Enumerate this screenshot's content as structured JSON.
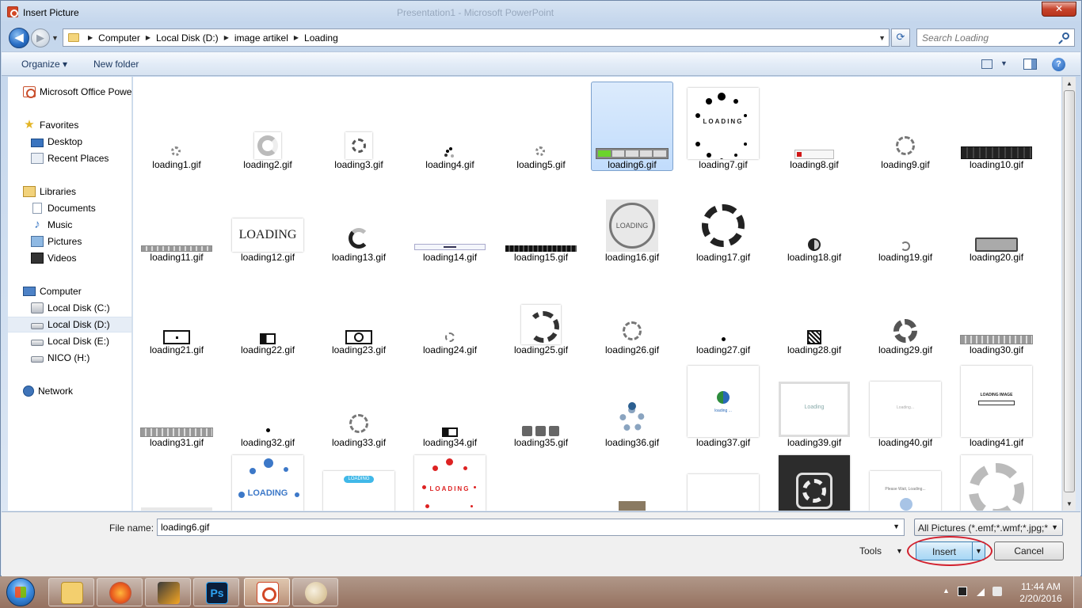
{
  "window": {
    "title": "Insert Picture",
    "background_title": "Presentation1 - Microsoft PowerPoint",
    "close_symbol": "✕"
  },
  "nav_buttons": {
    "back_symbol": "◀",
    "forward_symbol": "▶",
    "history_drop": "▼"
  },
  "address": {
    "crumbs": [
      "Computer",
      "Local Disk (D:)",
      "image artikel",
      "Loading"
    ],
    "refresh_symbol": "⟳",
    "search_placeholder": "Search Loading"
  },
  "toolbar": {
    "organize": "Organize ▾",
    "new_folder": "New folder",
    "help": "?"
  },
  "sidebar": {
    "items": [
      {
        "label": "Microsoft Office Powe",
        "icon": "powerpoint-icon"
      },
      {
        "label": "Favorites",
        "icon": "star-icon"
      },
      {
        "label": "Desktop",
        "icon": "desktop-icon"
      },
      {
        "label": "Recent Places",
        "icon": "recent-places-icon"
      },
      {
        "label": "Libraries",
        "icon": "library-icon"
      },
      {
        "label": "Documents",
        "icon": "document-icon"
      },
      {
        "label": "Music",
        "icon": "music-icon"
      },
      {
        "label": "Pictures",
        "icon": "pictures-icon"
      },
      {
        "label": "Videos",
        "icon": "videos-icon"
      },
      {
        "label": "Computer",
        "icon": "computer-icon"
      },
      {
        "label": "Local Disk (C:)",
        "icon": "drive-icon"
      },
      {
        "label": "Local Disk (D:)",
        "icon": "drive-icon"
      },
      {
        "label": "Local Disk (E:)",
        "icon": "drive-icon"
      },
      {
        "label": "NICO (H:)",
        "icon": "drive-icon"
      },
      {
        "label": "Network",
        "icon": "network-icon"
      }
    ],
    "selected": "Local Disk (D:)"
  },
  "files": [
    "loading1.gif",
    "loading2.gif",
    "loading3.gif",
    "loading4.gif",
    "loading5.gif",
    "loading6.gif",
    "loading7.gif",
    "loading8.gif",
    "loading9.gif",
    "loading10.gif",
    "loading11.gif",
    "loading12.gif",
    "loading13.gif",
    "loading14.gif",
    "loading15.gif",
    "loading16.gif",
    "loading17.gif",
    "loading18.gif",
    "loading19.gif",
    "loading20.gif",
    "loading21.gif",
    "loading22.gif",
    "loading23.gif",
    "loading24.gif",
    "loading25.gif",
    "loading26.gif",
    "loading27.gif",
    "loading28.gif",
    "loading29.gif",
    "loading30.gif",
    "loading31.gif",
    "loading32.gif",
    "loading33.gif",
    "loading34.gif",
    "loading35.gif",
    "loading36.gif",
    "loading37.gif",
    "loading39.gif",
    "loading40.gif",
    "loading41.gif"
  ],
  "selected_file": "loading6.gif",
  "thumb_texts": {
    "loading7": "LOADING",
    "loading12": "LOADING",
    "loading16": "LOADING",
    "loading37": "loading ...",
    "loading39": "Loading",
    "loading40": "Loading...",
    "loading41": "LOADING IMAGE",
    "row5_b": "LOADING",
    "row5_c": "LOADING",
    "row5_d": "LOADING",
    "row5_h": "Please Wait, Loading..."
  },
  "bottom": {
    "filename_label": "File name:",
    "filename_value": "loading6.gif",
    "filter": "All Pictures (*.emf;*.wmf;*.jpg;*",
    "tools": "Tools",
    "insert": "Insert",
    "cancel": "Cancel"
  },
  "taskbar": {
    "apps": [
      "explorer-icon",
      "firefox-icon",
      "winamp-icon",
      "photoshop-icon",
      "powerpoint-icon",
      "paint-icon"
    ],
    "ps_label": "Ps",
    "time": "11:44 AM",
    "date": "2/20/2016"
  },
  "colors": {
    "accent": "#3c7fb1",
    "highlight_ring": "#d21f2c",
    "selection": "#c1dcfc"
  }
}
